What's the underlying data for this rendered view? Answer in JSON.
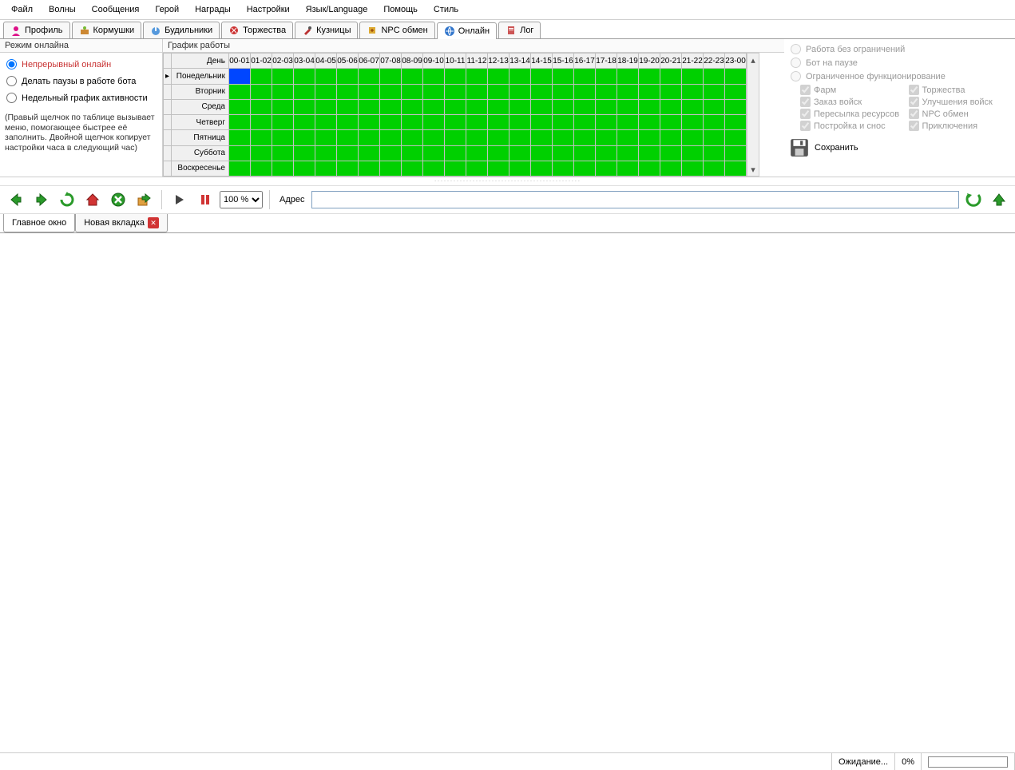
{
  "menu": [
    "Файл",
    "Волны",
    "Сообщения",
    "Герой",
    "Награды",
    "Настройки",
    "Язык/Language",
    "Помощь",
    "Стиль"
  ],
  "tabs": [
    {
      "icon": "profile",
      "label": "Профиль"
    },
    {
      "icon": "feeders",
      "label": "Кормушки"
    },
    {
      "icon": "alarms",
      "label": "Будильники"
    },
    {
      "icon": "celebrations",
      "label": "Торжества"
    },
    {
      "icon": "smithies",
      "label": "Кузницы"
    },
    {
      "icon": "npc",
      "label": "NPC обмен"
    },
    {
      "icon": "online",
      "label": "Онлайн",
      "active": true
    },
    {
      "icon": "log",
      "label": "Лог"
    }
  ],
  "left": {
    "header": "Режим онлайна",
    "options": [
      {
        "label": "Непрерывный онлайн",
        "selected": true
      },
      {
        "label": "Делать паузы в работе бота"
      },
      {
        "label": "Недельный график активности"
      }
    ],
    "hint": "(Правый щелчок по таблице вызывает меню, помогающее быстрее её заполнить. Двойной щелчок копирует настройки часа в следующий час)"
  },
  "grid": {
    "header": "График работы",
    "day_col": "День",
    "hours": [
      "00-01",
      "01-02",
      "02-03",
      "03-04",
      "04-05",
      "05-06",
      "06-07",
      "07-08",
      "08-09",
      "09-10",
      "10-11",
      "11-12",
      "12-13",
      "13-14",
      "14-15",
      "15-16",
      "16-17",
      "17-18",
      "18-19",
      "19-20",
      "20-21",
      "21-22",
      "22-23",
      "23-00"
    ],
    "days": [
      "Понедельник",
      "Вторник",
      "Среда",
      "Четверг",
      "Пятница",
      "Суббота",
      "Воскресенье"
    ]
  },
  "right": {
    "radios": [
      "Работа без ограничений",
      "Бот на паузе",
      "Ограниченное функционирование"
    ],
    "checks_left": [
      "Фарм",
      "Заказ войск",
      "Пересылка ресурсов",
      "Постройка и снос"
    ],
    "checks_right": [
      "Торжества",
      "Улучшения войск",
      "NPC обмен",
      "Приключения"
    ],
    "save": "Сохранить"
  },
  "toolbar": {
    "zoom": "100 %",
    "addr_label": "Адрес",
    "addr_value": ""
  },
  "lower_tabs": [
    {
      "label": "Главное окно",
      "active": true
    },
    {
      "label": "Новая вкладка",
      "close": true
    }
  ],
  "status": {
    "text": "Ожидание...",
    "progress": "0%"
  }
}
